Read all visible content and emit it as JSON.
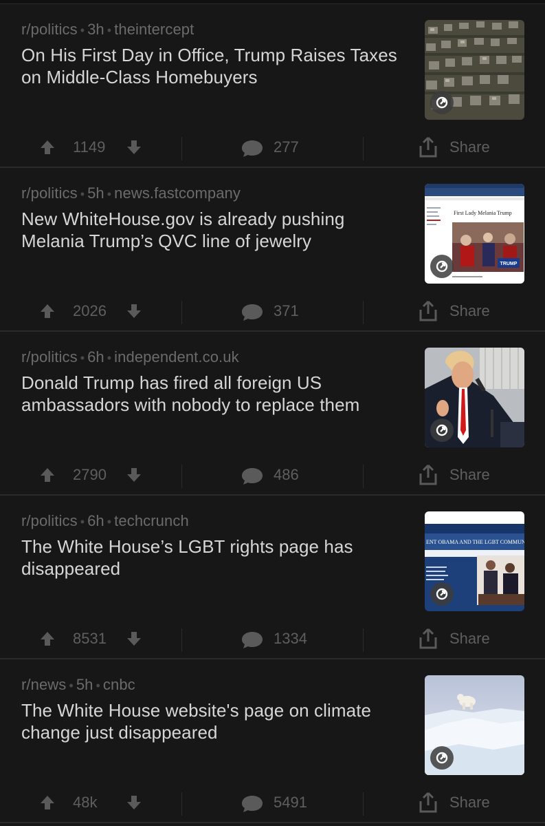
{
  "posts": [
    {
      "subreddit": "r/politics",
      "age": "3h",
      "domain": "theintercept",
      "title": "On His First Day in Office, Trump Raises Taxes on Middle-Class Homebuyers",
      "score": "1149",
      "comments": "277",
      "share_label": "Share",
      "thumbnail": "aerial-suburb-houses"
    },
    {
      "subreddit": "r/politics",
      "age": "5h",
      "domain": "news.fastcompany",
      "title": "New WhiteHouse.gov is already pushing Melania Trump’s QVC line of jewelry",
      "score": "2026",
      "comments": "371",
      "share_label": "Share",
      "thumbnail": "whitehouse-first-lady-page",
      "thumb_heading": "First Lady Melania Trump"
    },
    {
      "subreddit": "r/politics",
      "age": "6h",
      "domain": "independent.co.uk",
      "title": "Donald Trump has fired all foreign US ambassadors with nobody to replace them",
      "score": "2790",
      "comments": "486",
      "share_label": "Share",
      "thumbnail": "trump-speaking-podium"
    },
    {
      "subreddit": "r/politics",
      "age": "6h",
      "domain": "techcrunch",
      "title": "The White House’s LGBT rights page has disappeared",
      "score": "8531",
      "comments": "1334",
      "share_label": "Share",
      "thumbnail": "whitehouse-lgbt-page",
      "thumb_heading": "ENT OBAMA AND THE LGBT COMMUNITY"
    },
    {
      "subreddit": "r/news",
      "age": "5h",
      "domain": "cnbc",
      "title": "The White House website's page on climate change just disappeared",
      "score": "48k",
      "comments": "5491",
      "share_label": "Share",
      "thumbnail": "polar-bear-on-ice"
    }
  ],
  "colors": {
    "background": "#171717",
    "title_text": "#d6d6d6",
    "meta_text": "#6b6b6b",
    "action_text": "#5f5f5f",
    "separator": "#2b2b2b"
  }
}
